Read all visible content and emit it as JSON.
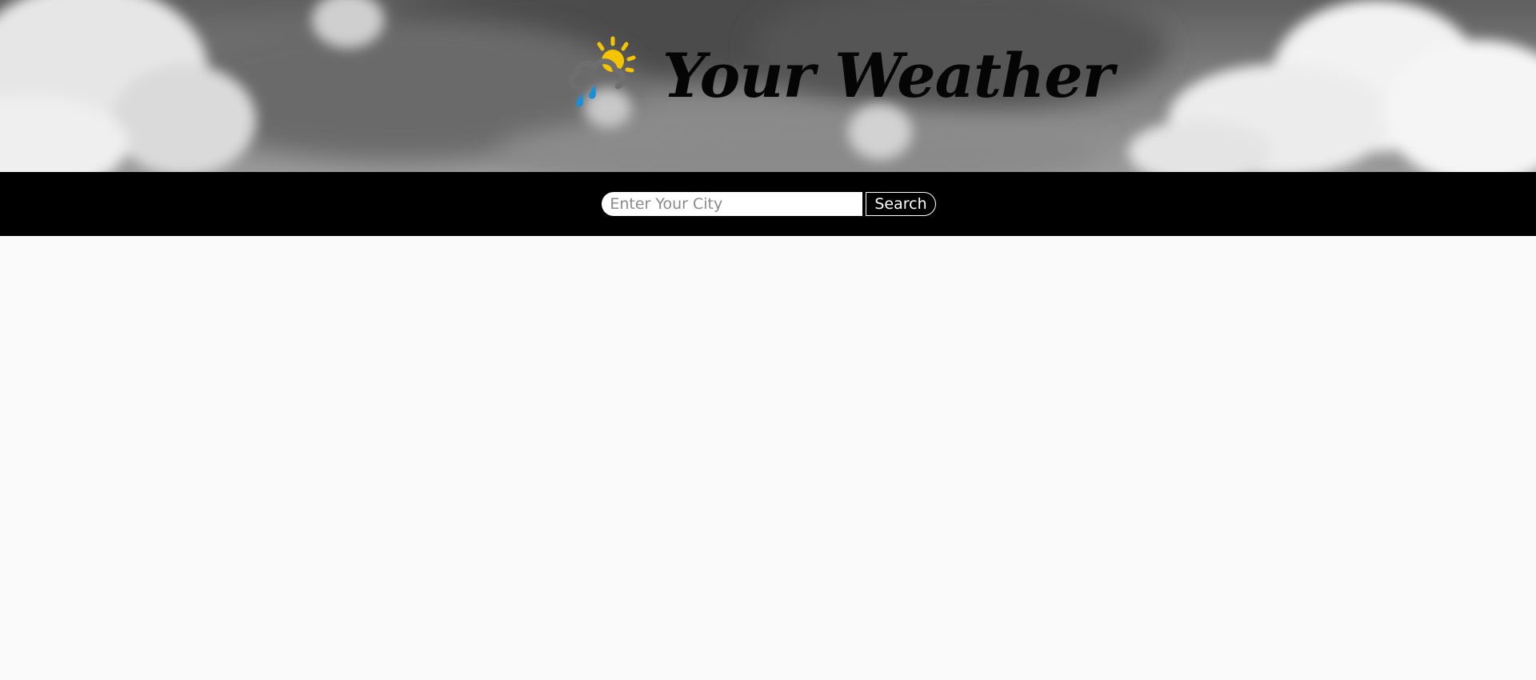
{
  "header": {
    "title": "Your Weather",
    "logo_icon": "partly-cloudy-rain-icon",
    "colors": {
      "sun": "#f5c400",
      "cloud": "#6e6e6e",
      "rain": "#1a8fd6"
    }
  },
  "search": {
    "placeholder": "Enter Your City",
    "value": "",
    "button_label": "Search"
  },
  "colors": {
    "search_bar_background": "#000000",
    "page_background": "#fafafa"
  }
}
